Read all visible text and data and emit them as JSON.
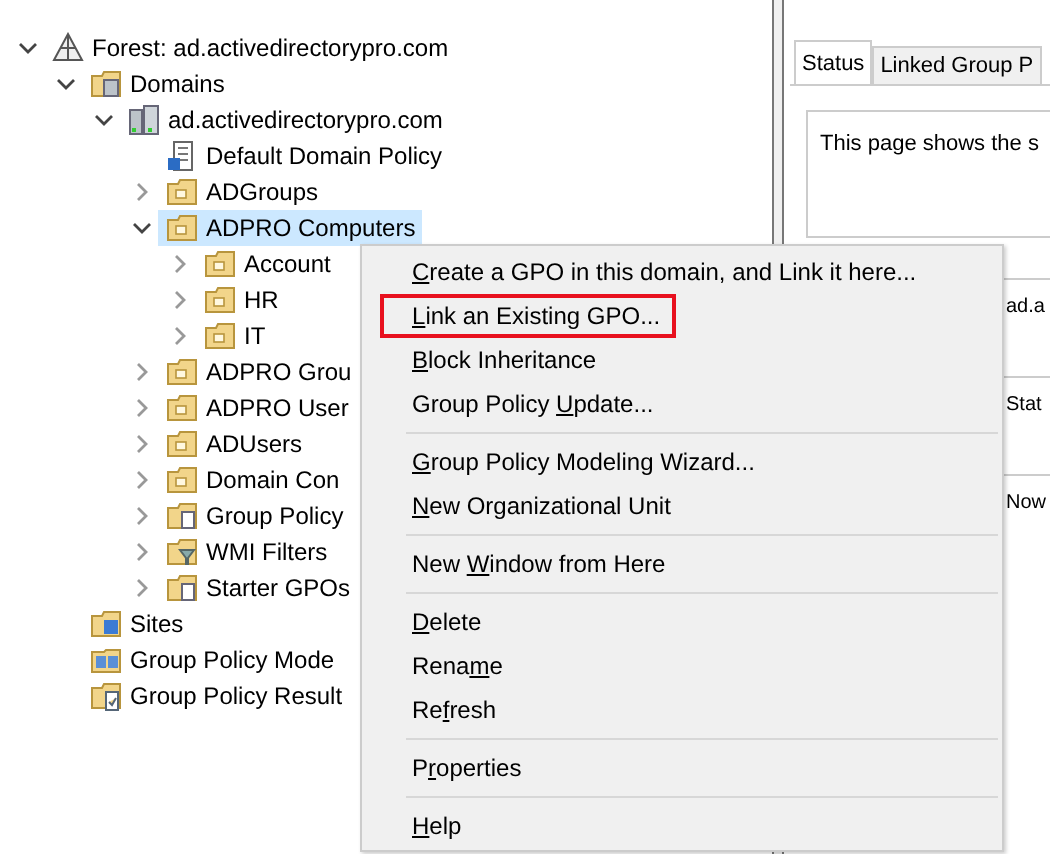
{
  "tree": [
    {
      "label": "Forest: ad.activedirectorypro.com",
      "kind": "forest",
      "expanded": true,
      "selected": false,
      "children": [
        {
          "label": "Domains",
          "kind": "domains",
          "expanded": true,
          "selected": false,
          "children": [
            {
              "label": "ad.activedirectorypro.com",
              "kind": "domain",
              "expanded": true,
              "selected": false,
              "children": [
                {
                  "label": "Default Domain Policy",
                  "kind": "gpo",
                  "selected": false
                },
                {
                  "label": "ADGroups",
                  "kind": "ou",
                  "expanded": false,
                  "selected": false
                },
                {
                  "label": "ADPRO Computers",
                  "kind": "ou",
                  "expanded": true,
                  "selected": true,
                  "children": [
                    {
                      "label": "Account",
                      "kind": "ou",
                      "expanded": false,
                      "selected": false
                    },
                    {
                      "label": "HR",
                      "kind": "ou",
                      "expanded": false,
                      "selected": false
                    },
                    {
                      "label": "IT",
                      "kind": "ou",
                      "expanded": false,
                      "selected": false
                    }
                  ]
                },
                {
                  "label": "ADPRO Grou",
                  "kind": "ou",
                  "expanded": false,
                  "selected": false
                },
                {
                  "label": "ADPRO User",
                  "kind": "ou",
                  "expanded": false,
                  "selected": false
                },
                {
                  "label": "ADUsers",
                  "kind": "ou",
                  "expanded": false,
                  "selected": false
                },
                {
                  "label": "Domain Con",
                  "kind": "ou",
                  "expanded": false,
                  "selected": false
                },
                {
                  "label": "Group Policy",
                  "kind": "gpo-container",
                  "expanded": false,
                  "selected": false
                },
                {
                  "label": "WMI Filters",
                  "kind": "wmi",
                  "expanded": false,
                  "selected": false
                },
                {
                  "label": "Starter GPOs",
                  "kind": "starter",
                  "expanded": false,
                  "selected": false
                }
              ]
            }
          ]
        },
        {
          "label": "Sites",
          "kind": "sites",
          "selected": false
        },
        {
          "label": "Group Policy Mode",
          "kind": "modeling",
          "selected": false
        },
        {
          "label": "Group Policy Result",
          "kind": "results",
          "selected": false
        }
      ]
    }
  ],
  "details": {
    "tabs": [
      {
        "label": "Status",
        "selected": true
      },
      {
        "label": "Linked Group P",
        "selected": false
      }
    ],
    "info_text": "This page shows the s",
    "rows": [
      "ad.a",
      "Stat",
      "Now"
    ]
  },
  "context_menu": {
    "groups": [
      [
        {
          "key": "C",
          "post": "reate a GPO in this domain, and Link it here...",
          "outlined": false
        },
        {
          "key": "L",
          "post": "ink an Existing GPO...",
          "outlined": true
        },
        {
          "key": "B",
          "post": "lock Inheritance",
          "outlined": false
        },
        {
          "pre": "Group Policy ",
          "key": "U",
          "post": "pdate...",
          "outlined": false
        }
      ],
      [
        {
          "key": "G",
          "post": "roup Policy Modeling Wizard...",
          "outlined": false
        },
        {
          "key": "N",
          "post": "ew Organizational Unit",
          "outlined": false
        }
      ],
      [
        {
          "pre": "New ",
          "key": "W",
          "post": "indow from Here",
          "outlined": false
        }
      ],
      [
        {
          "key": "D",
          "post": "elete",
          "outlined": false
        },
        {
          "pre": "Rena",
          "key": "m",
          "post": "e",
          "outlined": false
        },
        {
          "pre": "Re",
          "key": "f",
          "post": "resh",
          "outlined": false
        }
      ],
      [
        {
          "pre": "P",
          "key": "r",
          "post": "operties",
          "outlined": false
        }
      ],
      [
        {
          "key": "H",
          "post": "elp",
          "outlined": false
        }
      ]
    ]
  }
}
